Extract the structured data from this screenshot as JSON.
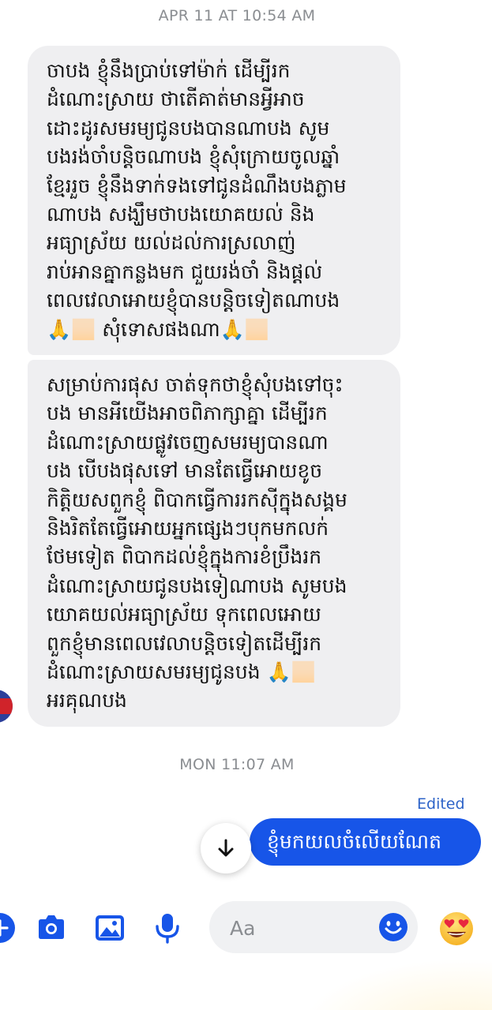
{
  "thread": {
    "timestamp_1": "APR 11 AT 10:54 AM",
    "timestamp_2": "MON 11:07 AM"
  },
  "incoming": {
    "message_1_lines": [
      "ចាបង ខ្ញុំនឹងប្រាប់ទៅម៉ាក់ ដើម្បីរក",
      "ដំណោះស្រាយ ថាតើគាត់មានអ្វីអាច",
      "ដោះដូរសមរម្យជូនបងបានណាបង សូម",
      "បងរង់ចាំបន្តិចណាបង ខ្ញុំសុំក្រោយចូលឆ្នាំ",
      "ខ្មែររួច ខ្ញុំនឹងទាក់ទងទៅជូនដំណឹងបងភ្លាម",
      "ណាបង សង្ឃឹមថាបងយោគយល់ និង",
      "អធ្យាស្រ័យ យល់ដល់ការស្រលាញ់",
      "រាប់អានគ្នាកន្លងមក ជួយរង់ចាំ និងផ្ដល់",
      "ពេលវេលាអោយខ្ញុំបានបន្តិចទៀតណាបង",
      "🙏🏻 សុំទោសផងណា🙏🏻"
    ],
    "message_2_lines": [
      "សម្រាប់ការផុស ចាត់ទុកថាខ្ញុំសុំបងទៅចុះ",
      "បង មានអីយើងអាចពិភាក្សាគ្នា ដើម្បីរក",
      "ដំណោះស្រាយផ្លូវចេញសមរម្យបានណា",
      "បង បើបងផុសទៅ មានតែធ្វើអោយខូច",
      "កិត្តិយសពួកខ្ញុំ ពិបាកធ្វើការរកស៊ីក្នុងសង្គម",
      "និងរិតតែធ្វើអោយអ្នកផ្សេងៗបុកមកលក់",
      "ថែមទៀត ពិបាកដល់ខ្ញុំក្នុងការខំប្រឹងរក",
      "ដំណោះស្រាយជូនបងទៀណាបង សូមបង",
      "យោគយល់អធ្យាស្រ័យ ទុកពេលអោយ",
      "ពួកខ្ញុំមានពេលវេលាបន្តិចទៀតដើម្បីរក",
      "ដំណោះស្រាយសមរម្យជូនបង 🙏🏻",
      "អរគុណបង"
    ]
  },
  "outgoing": {
    "edited_label": "Edited",
    "message": "ខ្ញុំមកយលចំលើយណែត"
  },
  "composer": {
    "placeholder": "Aa",
    "icons": [
      "plus-icon",
      "camera-icon",
      "image-icon",
      "microphone-icon",
      "smiley-icon",
      "heart-eyes-emoji-icon"
    ],
    "accent_color": "#1755e8"
  },
  "colors": {
    "incoming_bubble": "#efeff1",
    "outgoing_bubble": "#1755e8",
    "timestamp": "#8a8d91",
    "edited": "#2d63c8"
  }
}
